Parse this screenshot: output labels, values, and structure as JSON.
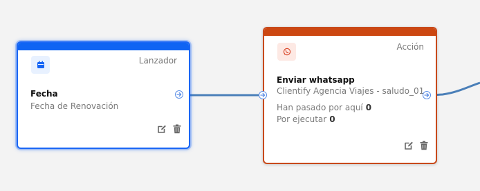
{
  "canvas": {
    "background": "#f3f3f3",
    "edge_color": "#4a7fb8"
  },
  "nodes": {
    "trigger": {
      "type_label": "Lanzador",
      "title": "Fecha",
      "subtitle": "Fecha de Renovación",
      "icon": "calendar-icon",
      "accent_color": "#0f64f3"
    },
    "action": {
      "type_label": "Acción",
      "title": "Enviar whatsapp",
      "subtitle": "Clientify Agencia Viajes - saludo_01",
      "icon": "whatsapp-icon",
      "accent_color": "#cc4711",
      "stats": [
        {
          "label": "Han pasado por aquí",
          "value": "0"
        },
        {
          "label": "Por ejecutar",
          "value": "0"
        }
      ]
    }
  }
}
